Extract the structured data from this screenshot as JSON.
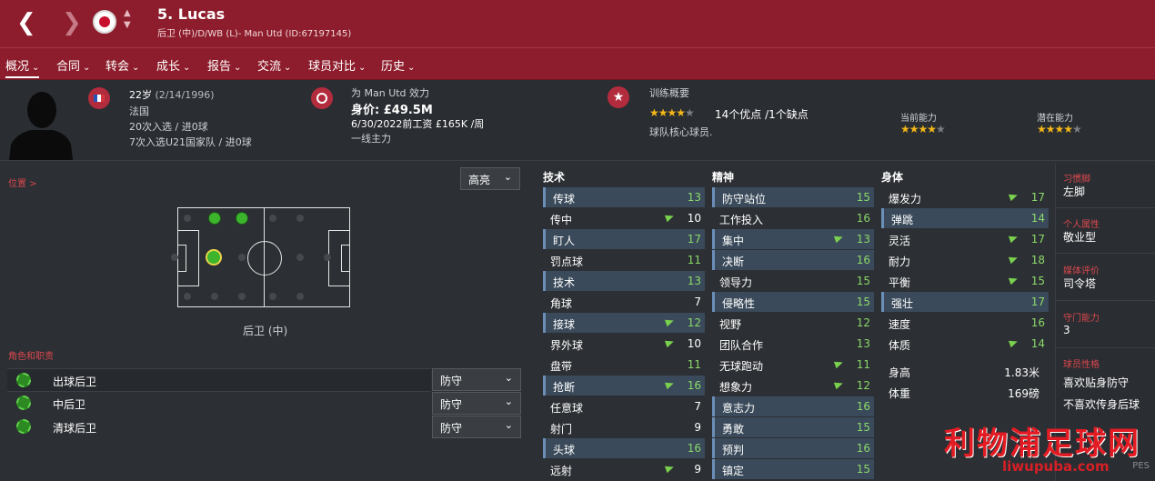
{
  "header": {
    "back_icon": "chevron-left-icon",
    "forward_icon": "chevron-right-icon",
    "player_name": "5. Lucas",
    "subtitle": "后卫 (中)/D/WB (L)- Man Utd (ID:67197145)",
    "up_arrow": "▲",
    "down_arrow": "▼"
  },
  "tabs": [
    {
      "label": "概况"
    },
    {
      "label": "合同"
    },
    {
      "label": "转会"
    },
    {
      "label": "成长"
    },
    {
      "label": "报告"
    },
    {
      "label": "交流"
    },
    {
      "label": "球员对比"
    },
    {
      "label": "历史"
    }
  ],
  "info": {
    "age": "22岁",
    "dob": "(2/14/1996)",
    "nation": "法国",
    "caps": "20次入选 / 进0球",
    "u21": "7次入选U21国家队 / 进0球",
    "plays_for": "为 Man Utd 效力",
    "value": "身价: £49.5M",
    "contract": "6/30/2022前工资 £165K /周",
    "status": "一线主力",
    "training_title": "训练概要",
    "training_summary": "14个优点 /1个缺点",
    "training_note": "球队核心球员.",
    "current_ability_label": "当前能力",
    "potential_ability_label": "潜在能力",
    "training_stars": 4,
    "current_stars": 4,
    "potential_stars": 4
  },
  "position": {
    "label": "位置 >",
    "highlight_dropdown": "高亮",
    "position_name": "后卫 (中)"
  },
  "roles": {
    "label": "角色和职责",
    "items": [
      {
        "name": "出球后卫",
        "duty": "防守"
      },
      {
        "name": "中后卫",
        "duty": "防守"
      },
      {
        "name": "清球后卫",
        "duty": "防守"
      }
    ]
  },
  "attributes": {
    "technical_title": "技术",
    "mental_title": "精神",
    "physical_title": "身体",
    "technical": [
      {
        "name": "传球",
        "value": "13",
        "hl": true,
        "arrow": false,
        "green": true
      },
      {
        "name": "传中",
        "value": "10",
        "hl": false,
        "arrow": true,
        "green": false
      },
      {
        "name": "盯人",
        "value": "17",
        "hl": true,
        "arrow": false,
        "green": true
      },
      {
        "name": "罚点球",
        "value": "11",
        "hl": false,
        "arrow": false,
        "green": true
      },
      {
        "name": "技术",
        "value": "13",
        "hl": true,
        "arrow": false,
        "green": true
      },
      {
        "name": "角球",
        "value": "7",
        "hl": false,
        "arrow": false,
        "green": false
      },
      {
        "name": "接球",
        "value": "12",
        "hl": true,
        "arrow": true,
        "green": true
      },
      {
        "name": "界外球",
        "value": "10",
        "hl": false,
        "arrow": true,
        "green": false
      },
      {
        "name": "盘带",
        "value": "11",
        "hl": false,
        "arrow": false,
        "green": true
      },
      {
        "name": "抢断",
        "value": "16",
        "hl": true,
        "arrow": true,
        "green": true
      },
      {
        "name": "任意球",
        "value": "7",
        "hl": false,
        "arrow": false,
        "green": false
      },
      {
        "name": "射门",
        "value": "9",
        "hl": false,
        "arrow": false,
        "green": false
      },
      {
        "name": "头球",
        "value": "16",
        "hl": true,
        "arrow": false,
        "green": true
      },
      {
        "name": "远射",
        "value": "9",
        "hl": false,
        "arrow": true,
        "green": false
      }
    ],
    "mental": [
      {
        "name": "防守站位",
        "value": "15",
        "hl": true,
        "arrow": false,
        "green": true
      },
      {
        "name": "工作投入",
        "value": "16",
        "hl": false,
        "arrow": false,
        "green": true
      },
      {
        "name": "集中",
        "value": "13",
        "hl": true,
        "arrow": true,
        "green": true
      },
      {
        "name": "决断",
        "value": "16",
        "hl": true,
        "arrow": false,
        "green": true
      },
      {
        "name": "领导力",
        "value": "15",
        "hl": false,
        "arrow": false,
        "green": true
      },
      {
        "name": "侵略性",
        "value": "15",
        "hl": true,
        "arrow": false,
        "green": true
      },
      {
        "name": "视野",
        "value": "12",
        "hl": false,
        "arrow": false,
        "green": true
      },
      {
        "name": "团队合作",
        "value": "13",
        "hl": false,
        "arrow": false,
        "green": true
      },
      {
        "name": "无球跑动",
        "value": "11",
        "hl": false,
        "arrow": true,
        "green": true
      },
      {
        "name": "想象力",
        "value": "12",
        "hl": false,
        "arrow": true,
        "green": true
      },
      {
        "name": "意志力",
        "value": "16",
        "hl": true,
        "arrow": false,
        "green": true
      },
      {
        "name": "勇敢",
        "value": "15",
        "hl": true,
        "arrow": false,
        "green": true
      },
      {
        "name": "预判",
        "value": "16",
        "hl": true,
        "arrow": false,
        "green": true
      },
      {
        "name": "镇定",
        "value": "15",
        "hl": true,
        "arrow": false,
        "green": true
      }
    ],
    "physical": [
      {
        "name": "爆发力",
        "value": "17",
        "hl": false,
        "arrow": true,
        "green": true
      },
      {
        "name": "弹跳",
        "value": "14",
        "hl": true,
        "arrow": false,
        "green": true
      },
      {
        "name": "灵活",
        "value": "17",
        "hl": false,
        "arrow": true,
        "green": true
      },
      {
        "name": "耐力",
        "value": "18",
        "hl": false,
        "arrow": true,
        "green": true
      },
      {
        "name": "平衡",
        "value": "15",
        "hl": false,
        "arrow": true,
        "green": true
      },
      {
        "name": "强壮",
        "value": "17",
        "hl": true,
        "arrow": false,
        "green": true
      },
      {
        "name": "速度",
        "value": "16",
        "hl": false,
        "arrow": false,
        "green": true
      },
      {
        "name": "体质",
        "value": "14",
        "hl": false,
        "arrow": true,
        "green": true
      }
    ],
    "height_label": "身高",
    "height_value": "1.83米",
    "weight_label": "体重",
    "weight_value": "169磅"
  },
  "sidebar": {
    "foot_label": "习惯脚",
    "foot_value": "左脚",
    "personality_label": "个人属性",
    "personality_value": "敬业型",
    "media_label": "媒体评价",
    "media_value": "司令塔",
    "gk_label": "守门能力",
    "gk_value": "3",
    "traits_label": "球员性格",
    "traits": [
      "喜欢贴身防守",
      "不喜欢传身后球"
    ]
  },
  "watermark": {
    "line1": "利物浦足球网",
    "line2": "liwupuba.com",
    "line3": "PES"
  },
  "colors": {
    "header_red": "#8d1d2c",
    "label_red": "#d9484f",
    "green_value": "#8bd86a",
    "star_gold": "#f4b719",
    "highlight_row": "#3a4a5a"
  }
}
